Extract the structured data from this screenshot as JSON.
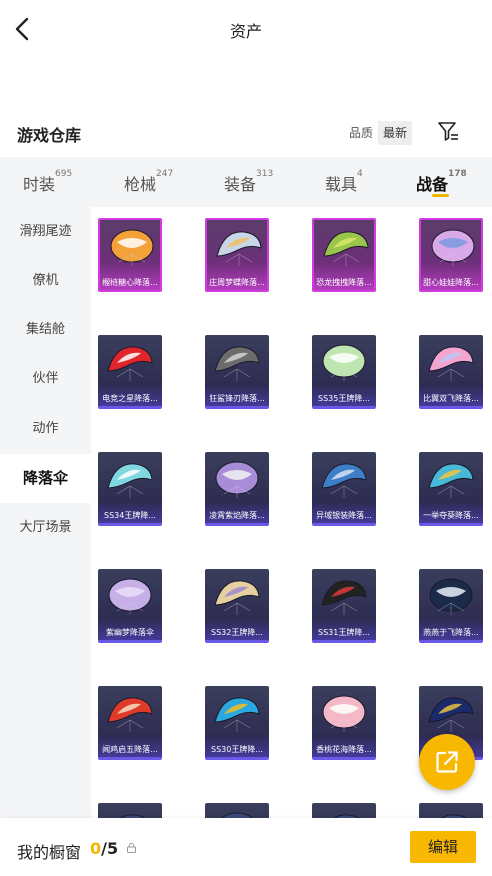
{
  "header": {
    "title": "资产",
    "back_icon": "chevron-left-icon"
  },
  "warehouse": {
    "title": "游戏仓库",
    "sort_options": [
      "品质",
      "最新"
    ],
    "sort_active": "最新",
    "filter_icon": "filter-icon"
  },
  "tabs": [
    {
      "label": "时装",
      "count": "695"
    },
    {
      "label": "枪械",
      "count": "247"
    },
    {
      "label": "装备",
      "count": "313"
    },
    {
      "label": "载具",
      "count": "4"
    },
    {
      "label": "战备",
      "count": "178",
      "active": true
    }
  ],
  "sidebar": {
    "items": [
      "滑翔尾迹",
      "僚机",
      "集结舱",
      "伙伴",
      "动作",
      "降落伞",
      "大厅场景"
    ],
    "active_index": 5
  },
  "items": [
    {
      "label": "榴梿糖心降落...",
      "rarity": "pink",
      "colors": [
        "#f5a13a",
        "#ffffff"
      ]
    },
    {
      "label": "庄周梦蝶降落...",
      "rarity": "pink",
      "colors": [
        "#c9d6e8",
        "#f0c060"
      ]
    },
    {
      "label": "恐龙拽拽降落...",
      "rarity": "pink",
      "colors": [
        "#9ac44a",
        "#d8e86a"
      ]
    },
    {
      "label": "甜心娃娃降落...",
      "rarity": "pink",
      "colors": [
        "#d9a8e8",
        "#7a9ae0"
      ]
    },
    {
      "label": "电竞之星降落...",
      "rarity": "purple",
      "colors": [
        "#e0262a",
        "#ffffff"
      ]
    },
    {
      "label": "狂鲨锋刃降落...",
      "rarity": "purple",
      "colors": [
        "#6c6c6c",
        "#d4d4d4"
      ]
    },
    {
      "label": "SS35王牌降...",
      "rarity": "purple",
      "colors": [
        "#bfe6b0",
        "#ffffff"
      ]
    },
    {
      "label": "比翼双飞降落...",
      "rarity": "purple",
      "colors": [
        "#f3a5d0",
        "#b8c8f5"
      ]
    },
    {
      "label": "SS34王牌降...",
      "rarity": "purple",
      "colors": [
        "#7fd8e0",
        "#ffffff"
      ]
    },
    {
      "label": "凌霄紫焰降落...",
      "rarity": "purple",
      "colors": [
        "#a98cd8",
        "#f2f2f2"
      ]
    },
    {
      "label": "异域银装降落...",
      "rarity": "purple",
      "colors": [
        "#3e7ec8",
        "#d8e4f0"
      ]
    },
    {
      "label": "一举夺葵降落...",
      "rarity": "purple",
      "colors": [
        "#48b8d8",
        "#f3c640"
      ]
    },
    {
      "label": "紫幽梦降落伞",
      "rarity": "purple",
      "colors": [
        "#c7b0e8",
        "#e8e0f8"
      ]
    },
    {
      "label": "SS32王牌降...",
      "rarity": "purple",
      "colors": [
        "#e6d0a0",
        "#9a8ad0"
      ]
    },
    {
      "label": "SS31王牌降...",
      "rarity": "purple",
      "colors": [
        "#222222",
        "#e03a3a"
      ]
    },
    {
      "label": "燕燕于飞降落...",
      "rarity": "purple",
      "colors": [
        "#1c2a4a",
        "#e8f0f8"
      ]
    },
    {
      "label": "闻鸡启五降落...",
      "rarity": "purple",
      "colors": [
        "#e03a2a",
        "#f5e0c0"
      ]
    },
    {
      "label": "SS30王牌降...",
      "rarity": "purple",
      "colors": [
        "#2aa8e0",
        "#f5c020"
      ]
    },
    {
      "label": "香桃花海降落...",
      "rarity": "purple",
      "colors": [
        "#f5b8c8",
        "#ffffff"
      ]
    },
    {
      "label": "",
      "rarity": "purple",
      "colors": [
        "#1a2a6a",
        "#e8c040"
      ]
    }
  ],
  "fab": {
    "icon": "share-external-icon"
  },
  "bottom": {
    "showcase_label": "我的橱窗",
    "showcase_current": "0",
    "showcase_total": "/5",
    "lock_icon": "lock-icon",
    "edit_label": "编辑"
  },
  "colors": {
    "accent": "#f8b700",
    "purple_border": "#6a58e6",
    "pink_border": "#d23ce0"
  }
}
